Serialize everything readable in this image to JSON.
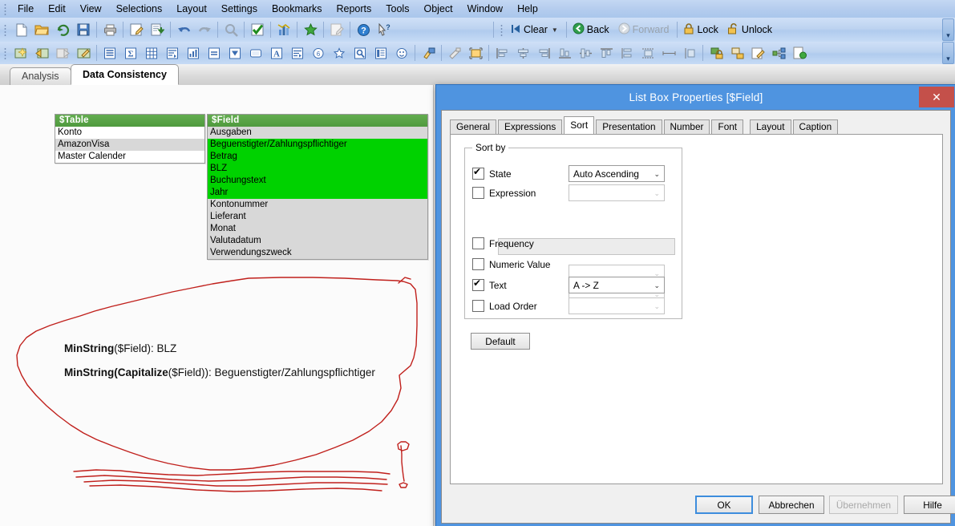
{
  "menubar": {
    "items": [
      {
        "label": "File"
      },
      {
        "label": "Edit"
      },
      {
        "label": "View"
      },
      {
        "label": "Selections"
      },
      {
        "label": "Layout"
      },
      {
        "label": "Settings"
      },
      {
        "label": "Bookmarks"
      },
      {
        "label": "Reports"
      },
      {
        "label": "Tools"
      },
      {
        "label": "Object"
      },
      {
        "label": "Window"
      },
      {
        "label": "Help"
      }
    ]
  },
  "toolbar_standard": {
    "buttons": [
      {
        "name": "new-icon"
      },
      {
        "name": "open-icon"
      },
      {
        "name": "reload-icon"
      },
      {
        "name": "save-icon"
      },
      {
        "name": "print-icon"
      },
      {
        "name": "edit-script-icon"
      },
      {
        "name": "export-icon"
      },
      {
        "name": "undo-icon"
      },
      {
        "name": "redo-icon"
      },
      {
        "name": "search-icon"
      },
      {
        "name": "current-selections-icon"
      },
      {
        "name": "chart-icon"
      },
      {
        "name": "bookmark-star-icon"
      },
      {
        "name": "notes-icon"
      },
      {
        "name": "help-icon"
      },
      {
        "name": "context-help-icon"
      }
    ],
    "clear_label": "Clear",
    "back_label": "Back",
    "forward_label": "Forward",
    "lock_label": "Lock",
    "unlock_label": "Unlock",
    "overflow_label": "▾"
  },
  "toolbar_design": {
    "buttons": [
      {
        "name": "new-sheet-icon"
      },
      {
        "name": "promote-sheet-icon"
      },
      {
        "name": "demote-sheet-icon"
      },
      {
        "name": "sheet-properties-icon"
      },
      {
        "name": "list-box-icon"
      },
      {
        "name": "statistics-box-icon"
      },
      {
        "name": "table-box-icon"
      },
      {
        "name": "pivot-table-icon"
      },
      {
        "name": "chart-object-icon"
      },
      {
        "name": "input-box-icon"
      },
      {
        "name": "multi-box-icon"
      },
      {
        "name": "button-icon"
      },
      {
        "name": "text-object-icon"
      },
      {
        "name": "line-arrow-object-icon"
      },
      {
        "name": "slider-calendar-icon"
      },
      {
        "name": "bookmark-object-icon"
      },
      {
        "name": "search-object-icon"
      },
      {
        "name": "container-icon"
      },
      {
        "name": "custom-object-icon"
      },
      {
        "name": "layout-theme-icon"
      },
      {
        "name": "format-painter-icon"
      },
      {
        "name": "fit-zoom-icon"
      },
      {
        "name": "align-left-icon"
      },
      {
        "name": "align-center-h-icon"
      },
      {
        "name": "align-right-icon"
      },
      {
        "name": "align-bottom-icon"
      },
      {
        "name": "align-center-v-icon"
      },
      {
        "name": "align-top-icon"
      },
      {
        "name": "distribute-v-icon"
      },
      {
        "name": "distribute-h-icon"
      },
      {
        "name": "same-width-icon"
      },
      {
        "name": "same-height-icon"
      },
      {
        "name": "lock-object-icon"
      },
      {
        "name": "unlock-object-icon"
      },
      {
        "name": "edit-module-icon"
      },
      {
        "name": "link-objects-icon"
      },
      {
        "name": "publish-icon"
      }
    ],
    "overflow_label": "▾"
  },
  "sheet_tabs": [
    {
      "label": "Analysis",
      "active": false
    },
    {
      "label": "Data Consistency",
      "active": true
    }
  ],
  "listboxes": [
    {
      "caption": "$Table",
      "rows": [
        {
          "value": "Konto",
          "state": "white"
        },
        {
          "value": "AmazonVisa",
          "state": "grey"
        },
        {
          "value": "Master Calender",
          "state": "white"
        }
      ]
    },
    {
      "caption": "$Field",
      "rows": [
        {
          "value": "Ausgaben",
          "state": "grey"
        },
        {
          "value": "Beguenstigter/Zahlungspflichtiger",
          "state": "selected"
        },
        {
          "value": "Betrag",
          "state": "selected"
        },
        {
          "value": "BLZ",
          "state": "selected"
        },
        {
          "value": "Buchungstext",
          "state": "selected"
        },
        {
          "value": "Jahr",
          "state": "selected"
        },
        {
          "value": "Kontonummer",
          "state": "grey"
        },
        {
          "value": "Lieferant",
          "state": "grey"
        },
        {
          "value": "Monat",
          "state": "grey"
        },
        {
          "value": "Valutadatum",
          "state": "grey"
        },
        {
          "value": "Verwendungszweck",
          "state": "grey"
        }
      ]
    }
  ],
  "annotations": {
    "ink_color": "#c0201c",
    "note1_bold": "MinString",
    "note1_rest": "($Field): BLZ",
    "note2_bold": "MinString",
    "note2_mid": "(",
    "note2_bold2": "Capitalize",
    "note2_rest": "($Field)):  Beguenstigter/Zahlungspflichtiger"
  },
  "dialog": {
    "title": "List Box Properties [$Field]",
    "close_label": "✕",
    "title_bar_color": "#4f94e0",
    "close_button_color": "#c4504a",
    "tabs": [
      {
        "label": "General",
        "active": false
      },
      {
        "label": "Expressions",
        "active": false
      },
      {
        "label": "Sort",
        "active": true
      },
      {
        "label": "Presentation",
        "active": false
      },
      {
        "label": "Number",
        "active": false
      },
      {
        "label": "Font",
        "active": false
      },
      {
        "label": "Layout",
        "active": false
      },
      {
        "label": "Caption",
        "active": false
      }
    ],
    "sort_by": {
      "group_title": "Sort by",
      "rows": [
        {
          "label": "State",
          "checked": true,
          "combo_value": "Auto Ascending",
          "combo_enabled": true
        },
        {
          "label": "Expression",
          "checked": false,
          "combo_value": "",
          "combo_enabled": false
        },
        {
          "label": "Frequency",
          "checked": false,
          "combo_value": "",
          "combo_enabled": false
        },
        {
          "label": "Numeric Value",
          "checked": false,
          "combo_value": "",
          "combo_enabled": false
        },
        {
          "label": "Text",
          "checked": true,
          "combo_value": "A -> Z",
          "combo_enabled": true
        },
        {
          "label": "Load Order",
          "checked": false,
          "combo_value": "",
          "combo_enabled": false
        }
      ],
      "expression_input_value": "",
      "combo_arrow": "⌄"
    },
    "default_button": "Default",
    "footer": {
      "ok": "OK",
      "cancel": "Abbrechen",
      "apply": "Übernehmen",
      "help": "Hilfe"
    }
  }
}
